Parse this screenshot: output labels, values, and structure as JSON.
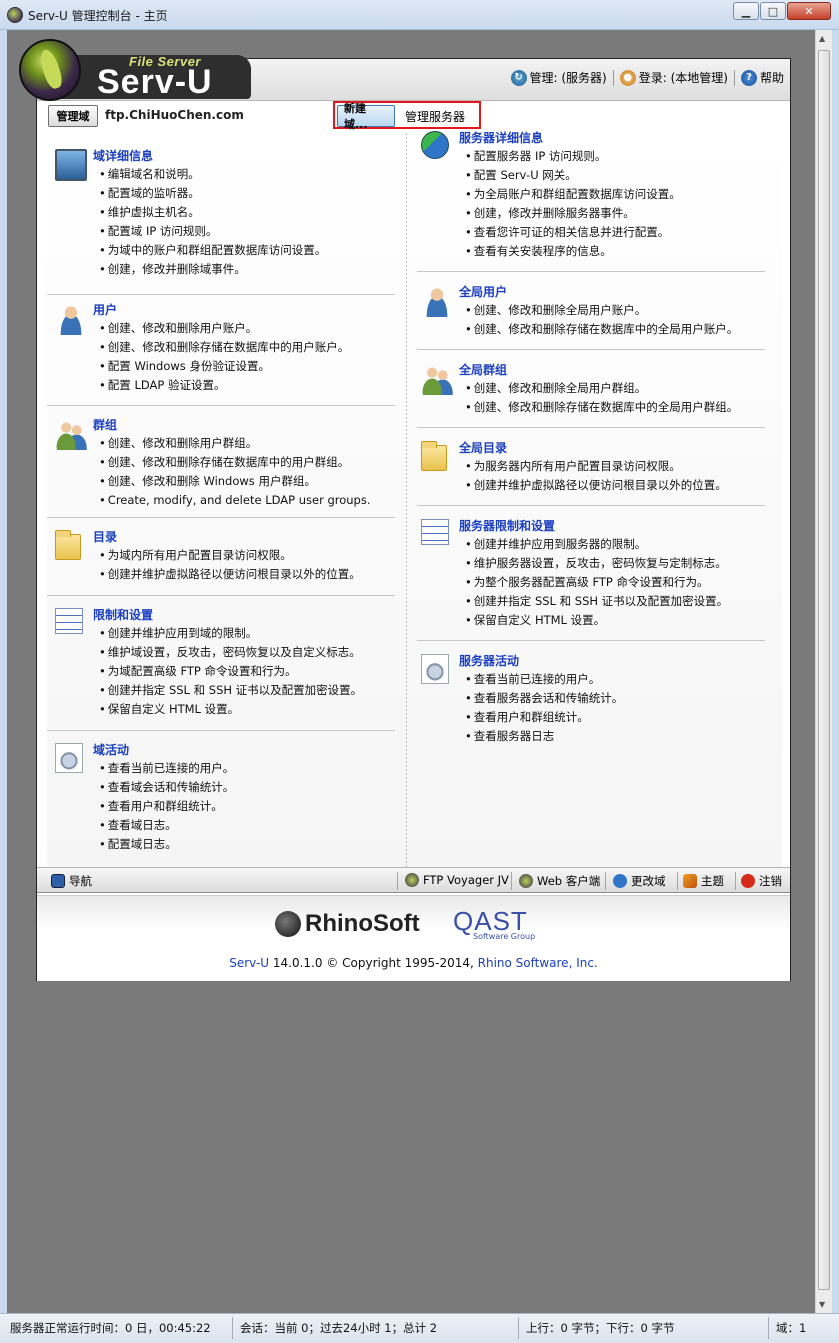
{
  "window": {
    "title": "Serv-U 管理控制台 - 主页",
    "min": "0",
    "max": "1",
    "close": "r"
  },
  "logo": {
    "small": "File Server",
    "big": "Serv-U"
  },
  "toplinks": {
    "manage": "管理: (服务器)",
    "login": "登录: (本地管理)",
    "help": "帮助"
  },
  "domainbar": {
    "manage_domain_btn": "管理域",
    "domain_name": "ftp.ChiHuoChen.com",
    "new_domain_btn": "新建域...",
    "manage_server": "管理服务器"
  },
  "left": [
    {
      "title": "域详细信息",
      "items": [
        "编辑域名和说明。",
        "配置域的监听器。",
        "维护虚拟主机名。",
        "配置域 IP 访问规则。",
        "为域中的账户和群组配置数据库访问设置。",
        "创建，修改并删除域事件。"
      ]
    },
    {
      "title": "用户",
      "items": [
        "创建、修改和删除用户账户。",
        "创建、修改和删除存储在数据库中的用户账户。",
        "配置 Windows 身份验证设置。",
        "配置 LDAP 验证设置。"
      ]
    },
    {
      "title": "群组",
      "items": [
        "创建、修改和删除用户群组。",
        "创建、修改和删除存储在数据库中的用户群组。",
        "创建、修改和删除 Windows 用户群组。",
        "Create, modify, and delete LDAP user groups."
      ]
    },
    {
      "title": "目录",
      "items": [
        "为域内所有用户配置目录访问权限。",
        "创建并维护虚拟路径以便访问根目录以外的位置。"
      ]
    },
    {
      "title": "限制和设置",
      "items": [
        "创建并维护应用到域的限制。",
        "维护域设置，反攻击，密码恢复以及自定义标志。",
        "为域配置高级 FTP 命令设置和行为。",
        "创建并指定 SSL 和 SSH 证书以及配置加密设置。",
        "保留自定义 HTML 设置。"
      ]
    },
    {
      "title": "域活动",
      "items": [
        "查看当前已连接的用户。",
        "查看域会话和传输统计。",
        "查看用户和群组统计。",
        "查看域日志。",
        "配置域日志。"
      ]
    }
  ],
  "right": [
    {
      "title": "服务器详细信息",
      "items": [
        "配置服务器 IP 访问规则。",
        "配置 Serv-U 网关。",
        "为全局账户和群组配置数据库访问设置。",
        "创建，修改并删除服务器事件。",
        "查看您许可证的相关信息并进行配置。",
        "查看有关安装程序的信息。"
      ]
    },
    {
      "title": "全局用户",
      "items": [
        "创建、修改和删除全局用户账户。",
        "创建、修改和删除存储在数据库中的全局用户账户。"
      ]
    },
    {
      "title": "全局群组",
      "items": [
        "创建、修改和删除全局用户群组。",
        "创建、修改和删除存储在数据库中的全局用户群组。"
      ]
    },
    {
      "title": "全局目录",
      "items": [
        "为服务器内所有用户配置目录访问权限。",
        "创建并维护虚拟路径以便访问根目录以外的位置。"
      ]
    },
    {
      "title": "服务器限制和设置",
      "items": [
        "创建并维护应用到服务器的限制。",
        "维护服务器设置，反攻击，密码恢复与定制标志。",
        "为整个服务器配置高级 FTP 命令设置和行为。",
        "创建并指定 SSL 和 SSH 证书以及配置加密设置。",
        "保留自定义 HTML 设置。"
      ]
    },
    {
      "title": "服务器活动",
      "items": [
        "查看当前已连接的用户。",
        "查看服务器会话和传输统计。",
        "查看用户和群组统计。",
        "查看服务器日志"
      ]
    }
  ],
  "navbar": {
    "nav": "导航",
    "ftp_voyager": "FTP Voyager JV",
    "web_client": "Web 客户端",
    "change_domain": "更改域",
    "theme": "主题",
    "logout": "注销"
  },
  "footer": {
    "rhino": "RhinoSoft",
    "qast": "QAST",
    "qast_sub": "Software Group",
    "product": "Serv-U",
    "version_text": " 14.0.1.0 © Copyright 1995-2014, ",
    "company": "Rhino Software, Inc."
  },
  "status": {
    "uptime": "服务器正常运行时间：0 日，00:45:22",
    "sessions": "会话：当前 0；过去24小时 1；总计 2",
    "transfer": "上行：0 字节；下行：0 字节",
    "domains": "域：1"
  },
  "colors": {
    "link": "#1a3fc0",
    "highlight": "#e4161d",
    "background": "#7a7a7a"
  }
}
